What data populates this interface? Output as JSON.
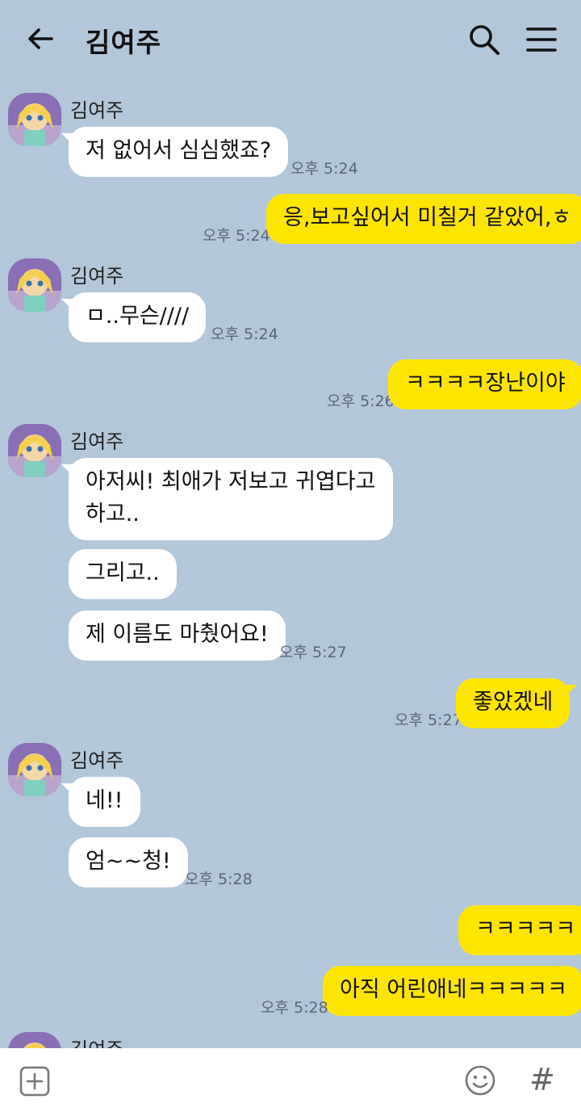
{
  "header": {
    "title": "김여주"
  },
  "sender_name": "김여주",
  "messages": [
    {
      "text": "저 없어서 심심했죠?",
      "time": "오후 5:24"
    },
    {
      "text": "응,보고싶어서 미칠거 같았어,ㅎ",
      "time": "오후 5:24"
    },
    {
      "text": "ㅁ..무슨////",
      "time": "오후 5:24"
    },
    {
      "text": "ㅋㅋㅋㅋ장난이야",
      "time": "오후 5:26"
    },
    {
      "line1": "아저씨! 최애가 저보고 귀엽다고",
      "line2": "하고.."
    },
    {
      "text": "그리고.."
    },
    {
      "text": "제 이름도 마췄어요!",
      "time": "오후 5:27"
    },
    {
      "text": "좋았겠네",
      "time": "오후 5:27"
    },
    {
      "text": "네!!"
    },
    {
      "text": "엄~~청!",
      "time": "오후 5:28"
    },
    {
      "text": "ㅋㅋㅋㅋㅋ"
    },
    {
      "text": "아직 어린애네ㅋㅋㅋㅋㅋ",
      "time": "오후 5:28"
    }
  ],
  "colors": {
    "background": "#b2c7da",
    "outgoing_bubble": "#fee500",
    "incoming_bubble": "#ffffff"
  },
  "icons": {
    "back": "arrow-left-icon",
    "search": "search-icon",
    "menu": "hamburger-menu-icon",
    "add": "plus-square-icon",
    "emoji": "smiley-icon",
    "hashtag": "hashtag-icon"
  },
  "input_bar": {
    "hashtag_glyph": "#"
  }
}
